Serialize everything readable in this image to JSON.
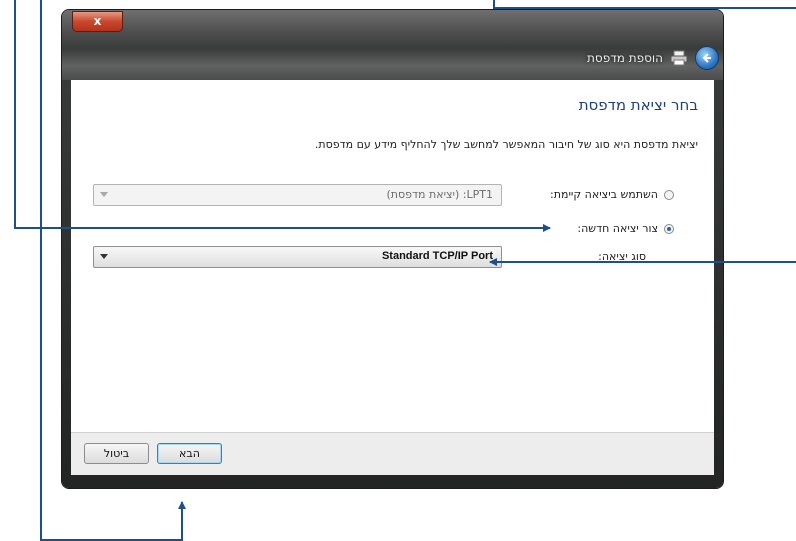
{
  "window": {
    "title": "הוספת מדפסת",
    "close_label": "x"
  },
  "page": {
    "heading": "בחר יציאת מדפסת",
    "description": "יציאת מדפסת היא סוג של חיבור המאפשר למחשב שלך להחליף מידע עם מדפסת."
  },
  "options": {
    "existing_port": {
      "label": "השתמש ביציאה קיימת:",
      "selected": false,
      "value": "LPT1: (יציאת מדפסת)"
    },
    "new_port": {
      "label": "צור יציאה חדשה:",
      "selected": true,
      "type_label": "סוג יציאה:",
      "type_value": "Standard TCP/IP Port"
    }
  },
  "buttons": {
    "next": "הבא",
    "cancel": "ביטול"
  },
  "colors": {
    "callout_line": "#1d4f8b",
    "heading": "#1f3f7a"
  },
  "icons": {
    "back": "back-arrow-icon",
    "printer": "printer-icon",
    "dropdown": "chevron-down-icon"
  }
}
